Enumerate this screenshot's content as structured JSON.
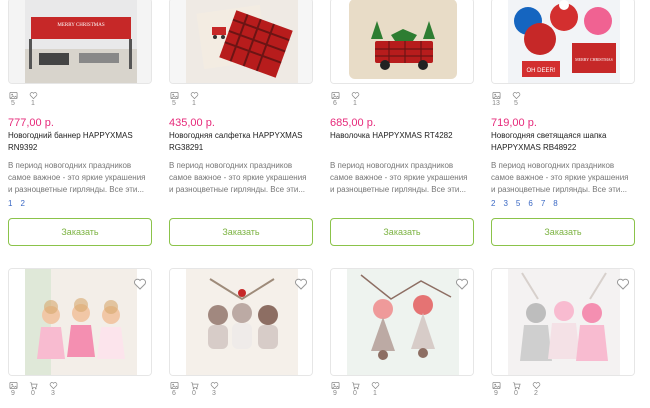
{
  "products_top": [
    {
      "stats": [
        "5",
        "1"
      ],
      "price": "777,00 р.",
      "title": "Новогодний баннер HAPPYXMAS RN9392",
      "desc": "В период новогодних праздников самое важное - это яркие украшения и разноцветные гирлянды. Все эти...",
      "pages": [
        "1",
        "2"
      ],
      "button": "Заказать",
      "banner_text": "MERRY CHRISTMAS"
    },
    {
      "stats": [
        "5",
        "1"
      ],
      "price": "435,00 р.",
      "title": "Новогодняя салфетка HAPPYXMAS RG38291",
      "desc": "В период новогодних праздников самое важное - это яркие украшения и разноцветные гирлянды. Все эти...",
      "pages": [],
      "button": "Заказать"
    },
    {
      "stats": [
        "6",
        "1"
      ],
      "price": "685,00 р.",
      "title": "Наволочка HAPPYXMAS RT4282",
      "desc": "В период новогодних праздников самое важное - это яркие украшения и разноцветные гирлянды. Все эти...",
      "pages": [],
      "button": "Заказать"
    },
    {
      "stats": [
        "13",
        "5"
      ],
      "price": "719,00 р.",
      "title": "Новогодняя светящаяся шапка HAPPYXMAS RB48922",
      "desc": "В период новогодних праздников самое важное - это яркие украшения и разноцветные гирлянды. Все эти...",
      "pages": [
        "2",
        "3",
        "5",
        "6",
        "7",
        "8"
      ],
      "button": "Заказать",
      "sign1": "OH DEER!",
      "sign2": "MERRY CHRISTMAS"
    }
  ],
  "products_bottom": [
    {
      "stats": [
        "9",
        "0",
        "3"
      ]
    },
    {
      "stats": [
        "6",
        "0",
        "3"
      ]
    },
    {
      "stats": [
        "9",
        "0",
        "1"
      ]
    },
    {
      "stats": [
        "9",
        "0",
        "2"
      ]
    }
  ],
  "colors": {
    "price": "#e6297a",
    "button_border": "#8bc34a",
    "button_text": "#7cb342",
    "link": "#3a68c4"
  }
}
